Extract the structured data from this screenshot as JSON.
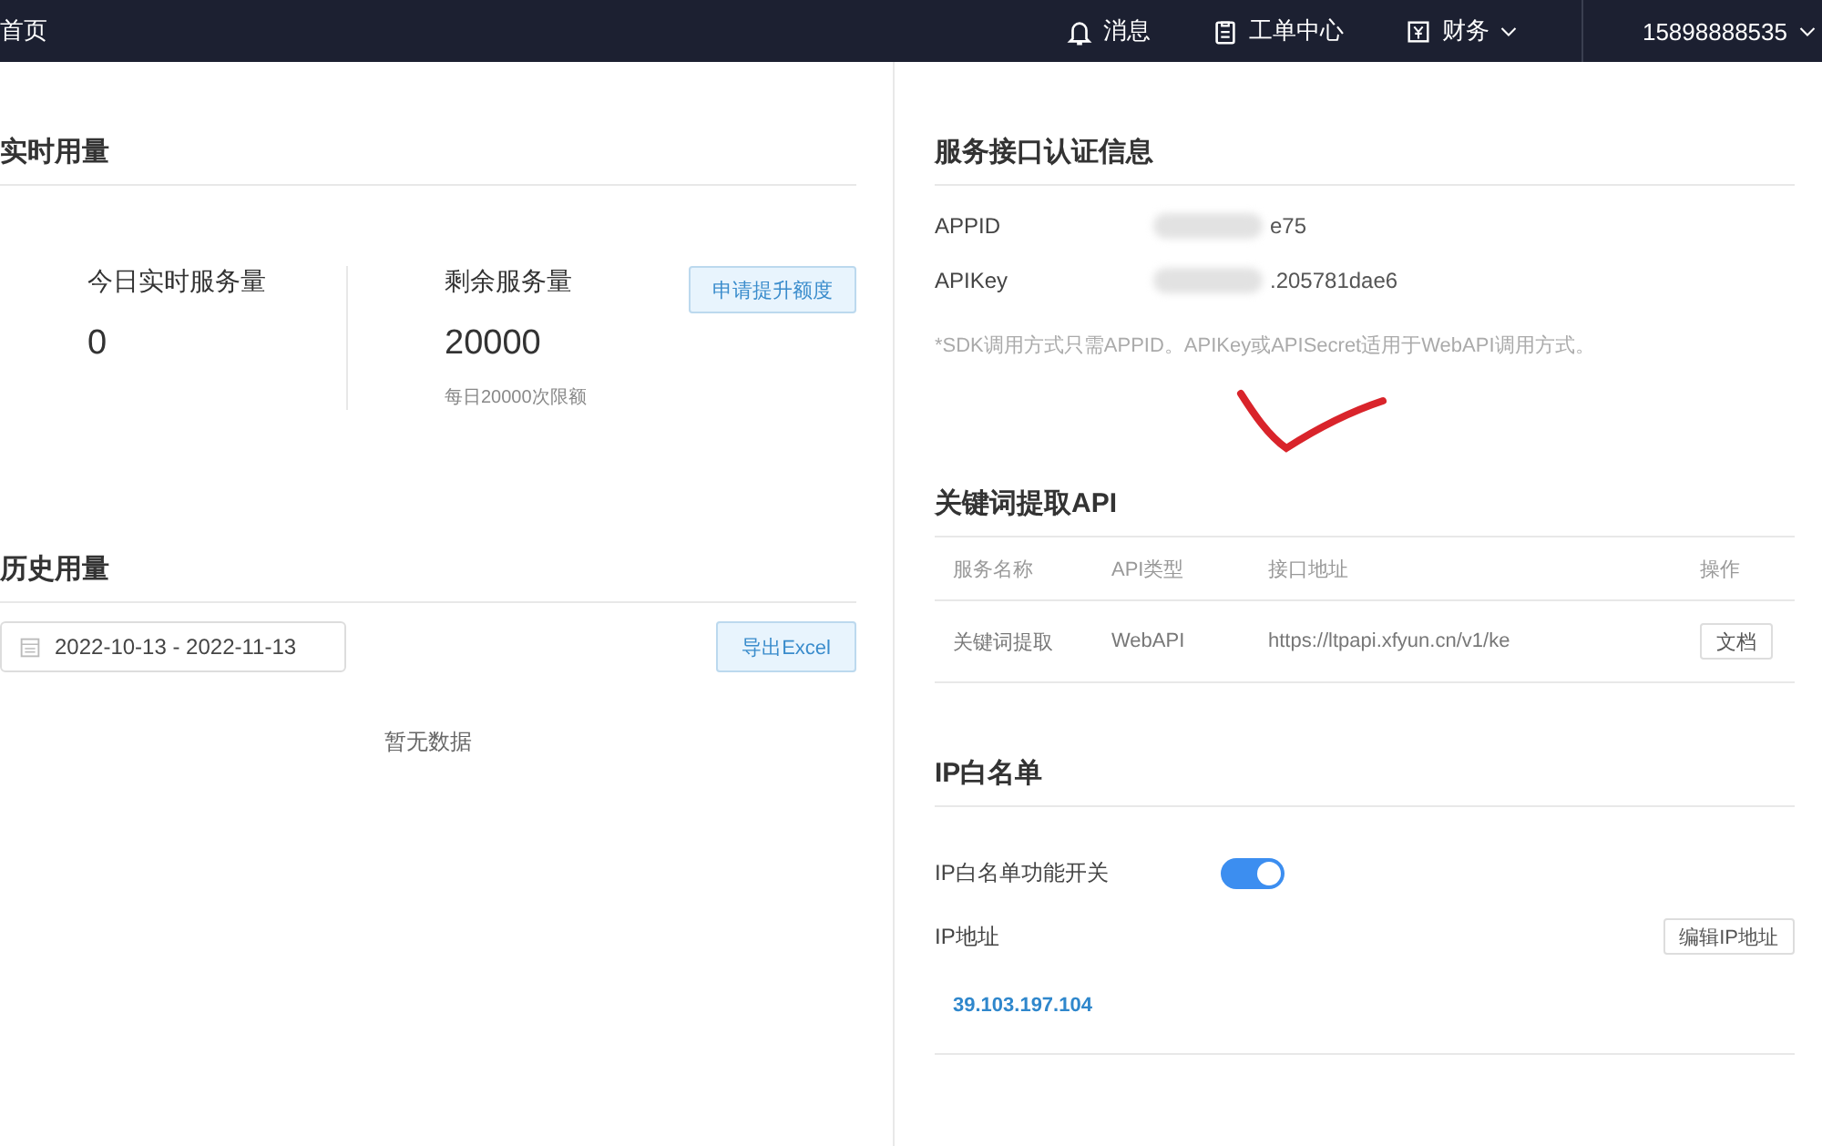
{
  "topbar": {
    "title": "首页",
    "nav": [
      {
        "kind": "bell",
        "label": "消息"
      },
      {
        "kind": "clipboard",
        "label": "工单中心"
      },
      {
        "kind": "finance",
        "label": "财务",
        "dropdown": true
      }
    ],
    "user": "15898888535",
    "user_dropdown": true
  },
  "realtime": {
    "title": "实时用量",
    "stats": [
      {
        "label": "今日实时服务量",
        "value": "0"
      },
      {
        "label": "剩余服务量",
        "value": "20000",
        "note": "每日20000次限额",
        "action": "申请提升额度"
      }
    ]
  },
  "history": {
    "title": "历史用量",
    "date_range": "2022-10-13  - 2022-11-13",
    "export_button": "导出Excel",
    "empty": "暂无数据"
  },
  "auth": {
    "title": "服务接口认证信息",
    "fields": [
      {
        "label": "APPID",
        "value": "e75",
        "redacted": true
      },
      {
        "label": "APIKey",
        "value": ".205781dae6",
        "redacted": true
      }
    ],
    "note": "*SDK调用方式只需APPID。APIKey或APISecret适用于WebAPI调用方式。",
    "check_mark": true
  },
  "api": {
    "title": "关键词提取API",
    "columns": [
      "服务名称",
      "API类型",
      "接口地址",
      "操作"
    ],
    "rows": [
      {
        "name": "关键词提取",
        "type": "WebAPI",
        "url": "https://ltpapi.xfyun.cn/v1/ke",
        "action": "文档"
      }
    ]
  },
  "whitelist": {
    "title": "IP白名单",
    "switch_label": "IP白名单功能开关",
    "on": true,
    "address_label": "IP地址",
    "edit_button": "编辑IP地址",
    "addresses": [
      "39.103.197.104"
    ]
  }
}
